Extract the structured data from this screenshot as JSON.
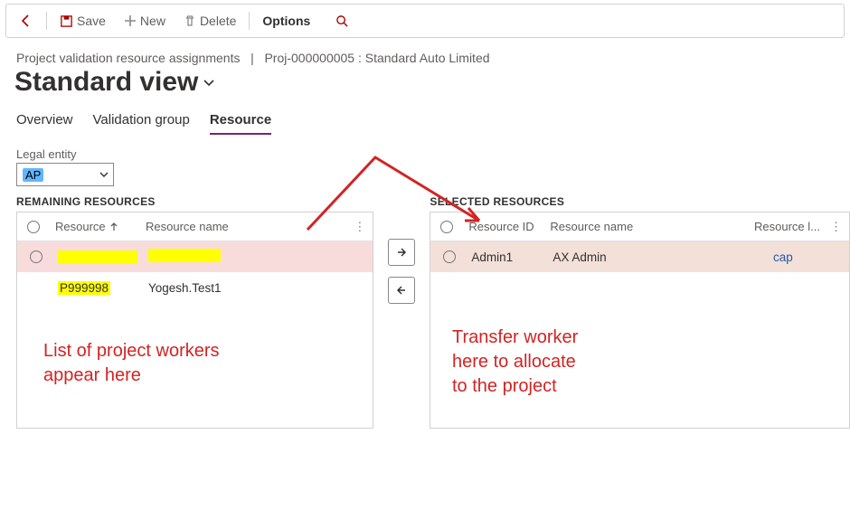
{
  "toolbar": {
    "save": "Save",
    "new": "New",
    "delete": "Delete",
    "options": "Options"
  },
  "breadcrumb": {
    "page": "Project validation resource assignments",
    "context": "Proj-000000005 : Standard Auto Limited"
  },
  "view_title": "Standard view",
  "tabs": {
    "overview": "Overview",
    "validation_group": "Validation group",
    "resource": "Resource"
  },
  "legal_entity": {
    "label": "Legal entity",
    "value": "AP"
  },
  "remaining": {
    "title": "REMAINING RESOURCES",
    "cols": {
      "resource": "Resource",
      "name": "Resource name"
    },
    "rows": [
      {
        "resource": "",
        "name": ""
      },
      {
        "resource": "P999998",
        "name": "Yogesh.Test1"
      }
    ]
  },
  "selected": {
    "title": "SELECTED RESOURCES",
    "cols": {
      "rid": "Resource ID",
      "name": "Resource name",
      "legal": "Resource l..."
    },
    "rows": [
      {
        "rid": "Admin1",
        "name": "AX Admin",
        "legal": "cap"
      }
    ]
  },
  "annotations": {
    "left": "List of project workers\nappear here",
    "right": "Transfer worker\nhere to allocate\nto the project"
  }
}
